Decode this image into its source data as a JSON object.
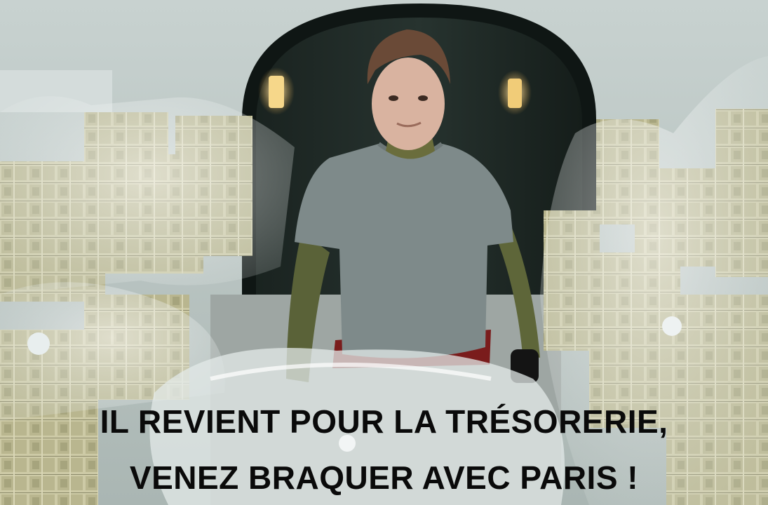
{
  "meme": {
    "caption_line_1": "IL REVIENT POUR LA TRÉSORERIE,",
    "caption_line_2": "VENEZ BRAQUER AVEC PARIS !"
  },
  "scene": {
    "setting": "bank vault",
    "wall_color": "#b9c4c2",
    "vault_door_color": "#1f2a26",
    "shirt_color": "#7e8a8a",
    "shorts_color": "#7a1c1c",
    "cash_color": "#c9c7a4"
  }
}
